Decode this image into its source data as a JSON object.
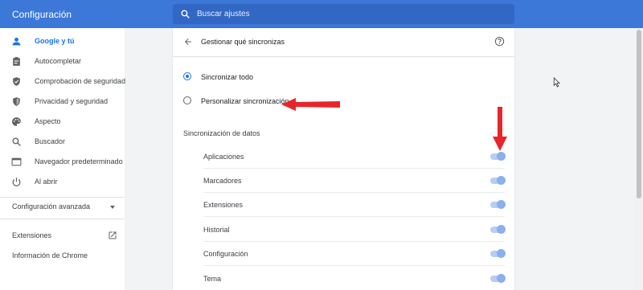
{
  "header": {
    "title": "Configuración",
    "search_placeholder": "Buscar ajustes"
  },
  "sidebar": {
    "items": [
      {
        "label": "Google y tú",
        "icon": "person-icon",
        "active": true
      },
      {
        "label": "Autocompletar",
        "icon": "clipboard-icon",
        "active": false
      },
      {
        "label": "Comprobación de seguridad",
        "icon": "shield-check-icon",
        "active": false
      },
      {
        "label": "Privacidad y seguridad",
        "icon": "shield-icon",
        "active": false
      },
      {
        "label": "Aspecto",
        "icon": "palette-icon",
        "active": false
      },
      {
        "label": "Buscador",
        "icon": "search-icon",
        "active": false
      },
      {
        "label": "Navegador predeterminado",
        "icon": "browser-icon",
        "active": false
      },
      {
        "label": "Al abrir",
        "icon": "power-icon",
        "active": false
      }
    ],
    "advanced_label": "Configuración avanzada",
    "extensions_label": "Extensiones",
    "about_label": "Información de Chrome"
  },
  "main": {
    "title": "Gestionar qué sincronizas",
    "radio_options": [
      {
        "label": "Sincronizar todo",
        "selected": true
      },
      {
        "label": "Personalizar sincronización",
        "selected": false
      }
    ],
    "section_title": "Sincronización de datos",
    "sync_items": [
      {
        "label": "Aplicaciones",
        "enabled": true
      },
      {
        "label": "Marcadores",
        "enabled": true
      },
      {
        "label": "Extensiones",
        "enabled": true
      },
      {
        "label": "Historial",
        "enabled": true
      },
      {
        "label": "Configuración",
        "enabled": true
      },
      {
        "label": "Tema",
        "enabled": true
      }
    ]
  },
  "colors": {
    "header_bg": "#3c78d8",
    "accent": "#1a73e8",
    "annotation_arrow": "#e8262a"
  }
}
